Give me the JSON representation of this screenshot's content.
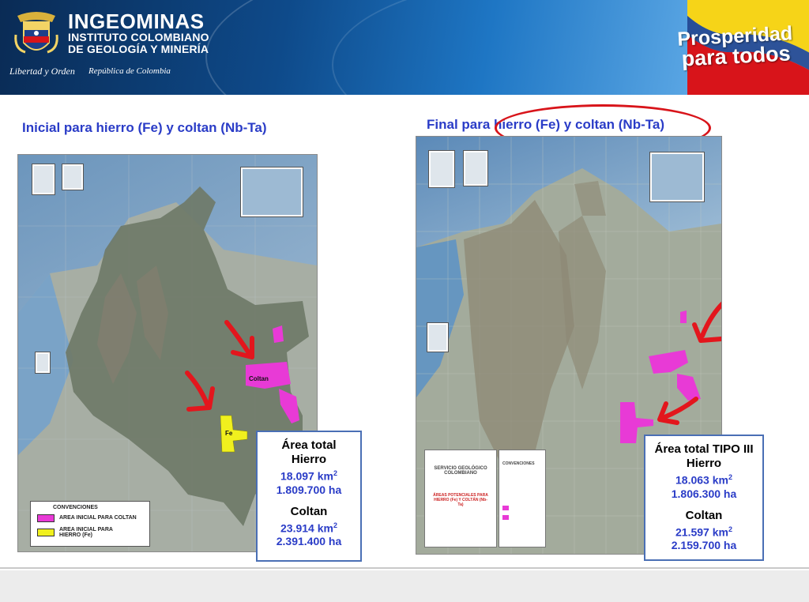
{
  "header": {
    "org_name": "INGEOMINAS",
    "org_line1": "INSTITUTO COLOMBIANO",
    "org_line2": "DE GEOLOGÍA Y MINERÍA",
    "motto": "Libertad y Orden",
    "country": "República de Colombia",
    "slogan_line1": "Prosperidad",
    "slogan_line2": "para todos"
  },
  "left_panel": {
    "title": "Inicial para hierro (Fe) y coltan (Nb-Ta)",
    "map_labels": {
      "coltan": "Coltan",
      "fe": "Fe"
    },
    "legend": {
      "title": "CONVENCIONES",
      "items": [
        {
          "label": "AREA INICIAL PARA COLTAN",
          "color": "#e83ad6"
        },
        {
          "label": "AREA INICIAL PARA HIERRO (Fe)",
          "color": "#f0f01e"
        }
      ]
    },
    "stats": {
      "heading1": "Área total",
      "heading2": "Hierro",
      "hierro_km": "18.097 km",
      "hierro_ha": "1.809.700 ha",
      "heading3": "Coltan",
      "coltan_km": "23.914 km",
      "coltan_ha": "2.391.400 ha",
      "unit_exp": "2"
    }
  },
  "right_panel": {
    "title": "Final para hierro (Fe) y coltan (Nb-Ta)",
    "reference_sheet": {
      "org": "SERVICIO GEOLÓGICO COLOMBIANO",
      "conv": "CONVENCIONES",
      "map_title": "ÁREAS POTENCIALES PARA HIERRO (Fe) Y COLTÁN (Nb-Ta)"
    },
    "stats": {
      "heading1": "Área total TIPO III",
      "heading2": "Hierro",
      "hierro_km": "18.063 km",
      "hierro_ha": "1.806.300 ha",
      "heading3": "Coltan",
      "coltan_km": "21.597 km",
      "coltan_ha": "2.159.700 ha",
      "unit_exp": "2"
    }
  },
  "colors": {
    "title_blue": "#2a3cc7",
    "highlight_red": "#d8141a",
    "coltan_magenta": "#e83ad6",
    "hierro_yellow": "#f0f01e",
    "colombia_fill": "#6f7a68"
  }
}
